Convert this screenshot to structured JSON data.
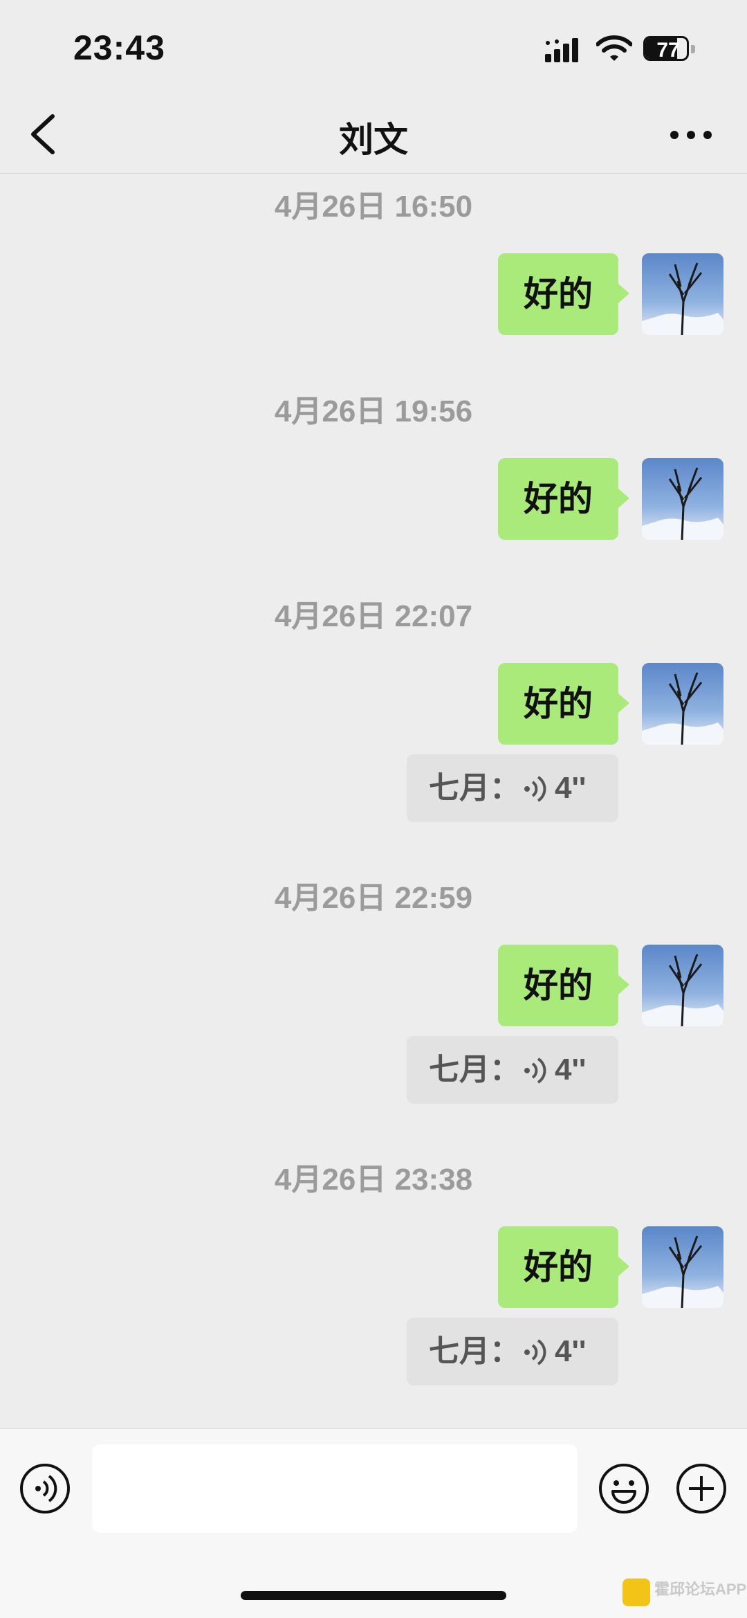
{
  "status_bar": {
    "time": "23:43",
    "battery_level": "77"
  },
  "nav": {
    "title": "刘文"
  },
  "messages": [
    {
      "timestamp": "4月26日 16:50",
      "text": "好的"
    },
    {
      "timestamp": "4月26日 19:56",
      "text": "好的"
    },
    {
      "timestamp": "4月26日 22:07",
      "text": "好的",
      "quote": {
        "sender": "七月：",
        "duration": "4''"
      }
    },
    {
      "timestamp": "4月26日 22:59",
      "text": "好的",
      "quote": {
        "sender": "七月：",
        "duration": "4''"
      }
    },
    {
      "timestamp": "4月26日 23:38",
      "text": "好的",
      "quote": {
        "sender": "七月：",
        "duration": "4''"
      }
    }
  ],
  "input_bar": {
    "placeholder": ""
  },
  "watermark": {
    "text": "霍邱论坛APP"
  },
  "colors": {
    "bubble_self": "#a9ea7a",
    "background": "#ededed",
    "timestamp": "#9b9b9b"
  }
}
